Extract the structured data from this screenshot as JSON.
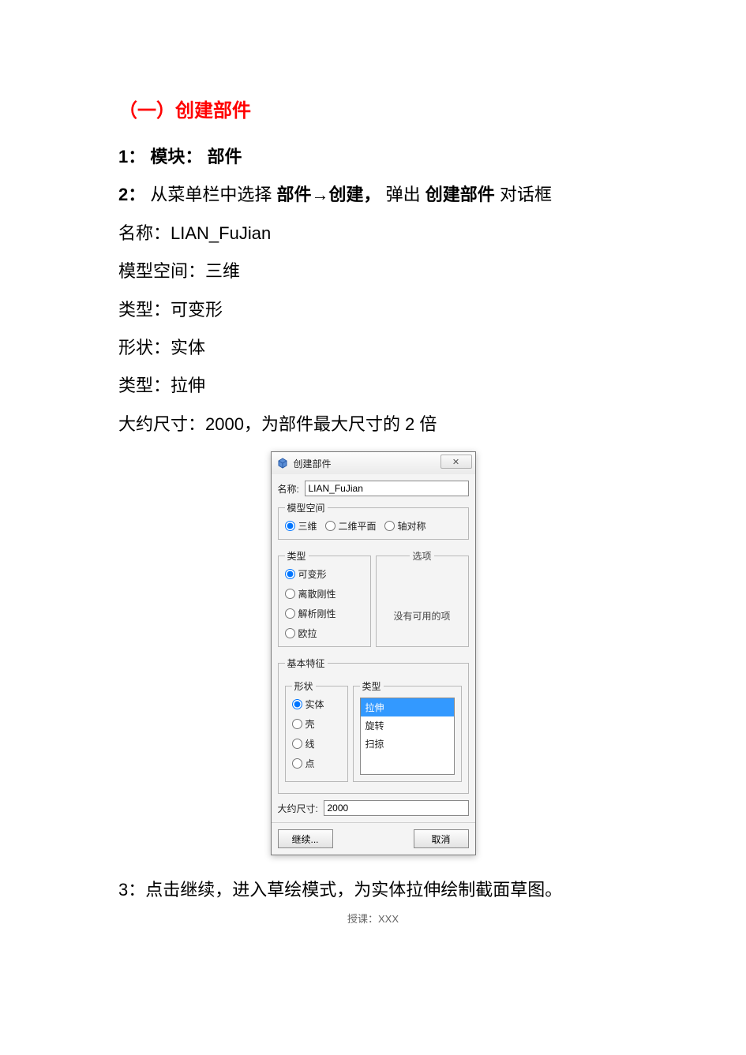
{
  "doc": {
    "section_title": "（一）创建部件",
    "line1_num": "1：",
    "line1_label": "模块：",
    "line1_val": "部件",
    "line2_num": "2：",
    "line2_pre": "从菜单栏中选择",
    "line2_bold1": "部件→创建，",
    "line2_mid": "弹出",
    "line2_bold2": "创建部件",
    "line2_post": "对话框",
    "line_name": "名称：LIAN_FuJian",
    "line_space": "模型空间：三维",
    "line_type1": "类型：可变形",
    "line_shape": "形状：实体",
    "line_type2": "类型：拉伸",
    "line_size": "大约尺寸：2000，为部件最大尺寸的 2 倍",
    "line3": "3：点击继续，进入草绘模式，为实体拉伸绘制截面草图。",
    "footer": "授课：XXX"
  },
  "dialog": {
    "title": "创建部件",
    "close": "✕",
    "name_label": "名称:",
    "name_value": "LIAN_FuJian",
    "modelspace": {
      "legend": "模型空间",
      "opt_3d": "三维",
      "opt_2d": "二维平面",
      "opt_axi": "轴对称",
      "selected": "三维"
    },
    "type": {
      "legend": "类型",
      "opt_def": "可变形",
      "opt_discrete": "离散刚性",
      "opt_analytic": "解析刚性",
      "opt_euler": "欧拉",
      "selected": "可变形"
    },
    "options": {
      "legend": "选项",
      "empty": "没有可用的项"
    },
    "basefeat": {
      "legend": "基本特征",
      "shape_legend": "形状",
      "shape_solid": "实体",
      "shape_shell": "壳",
      "shape_wire": "线",
      "shape_point": "点",
      "shape_selected": "实体",
      "type_legend": "类型",
      "type_extrude": "拉伸",
      "type_rotate": "旋转",
      "type_sweep": "扫掠",
      "type_selected": "拉伸"
    },
    "size_label": "大约尺寸:",
    "size_value": "2000",
    "btn_continue": "继续...",
    "btn_cancel": "取消"
  }
}
